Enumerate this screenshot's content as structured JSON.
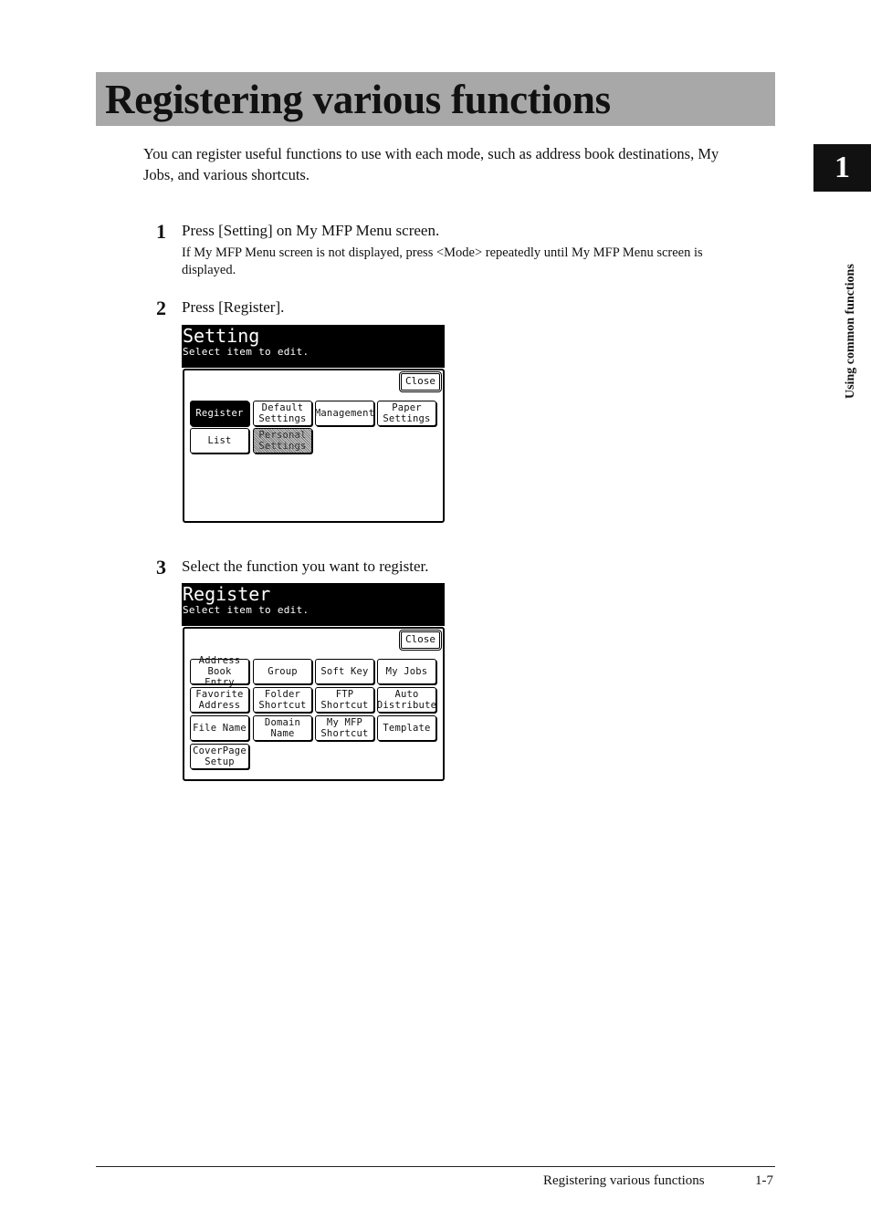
{
  "title": "Registering various functions",
  "intro": "You can register useful functions to use with each mode, such as address book destinations, My Jobs, and various shortcuts.",
  "chapter_tab": "1",
  "side_label": "Using common functions",
  "steps": [
    {
      "num": "1",
      "text": "Press [Setting] on My MFP Menu screen.",
      "note": "If My MFP Menu screen is not displayed, press <Mode> repeatedly until My MFP Menu screen is displayed."
    },
    {
      "num": "2",
      "text": "Press [Register]."
    },
    {
      "num": "3",
      "text": "Select the function you want to register."
    }
  ],
  "screen1": {
    "title": "Setting",
    "subtitle": "Select item to edit.",
    "close": "Close",
    "buttons": [
      "Register",
      "Default\nSettings",
      "Management",
      "Paper\nSettings",
      "List",
      "Personal\nSettings"
    ],
    "selected": "Register",
    "disabled": "Personal Settings"
  },
  "screen2": {
    "title": "Register",
    "subtitle": "Select item to edit.",
    "close": "Close",
    "buttons": [
      "Address\nBook Entry",
      "Group",
      "Soft Key",
      "My Jobs",
      "Favorite\nAddress",
      "Folder\nShortcut",
      "FTP\nShortcut",
      "Auto\nDistribute",
      "File Name",
      "Domain\nName",
      "My MFP\nShortcut",
      "Template",
      "CoverPage\nSetup"
    ]
  },
  "footer": {
    "text": "Registering various functions",
    "page": "1-7"
  }
}
